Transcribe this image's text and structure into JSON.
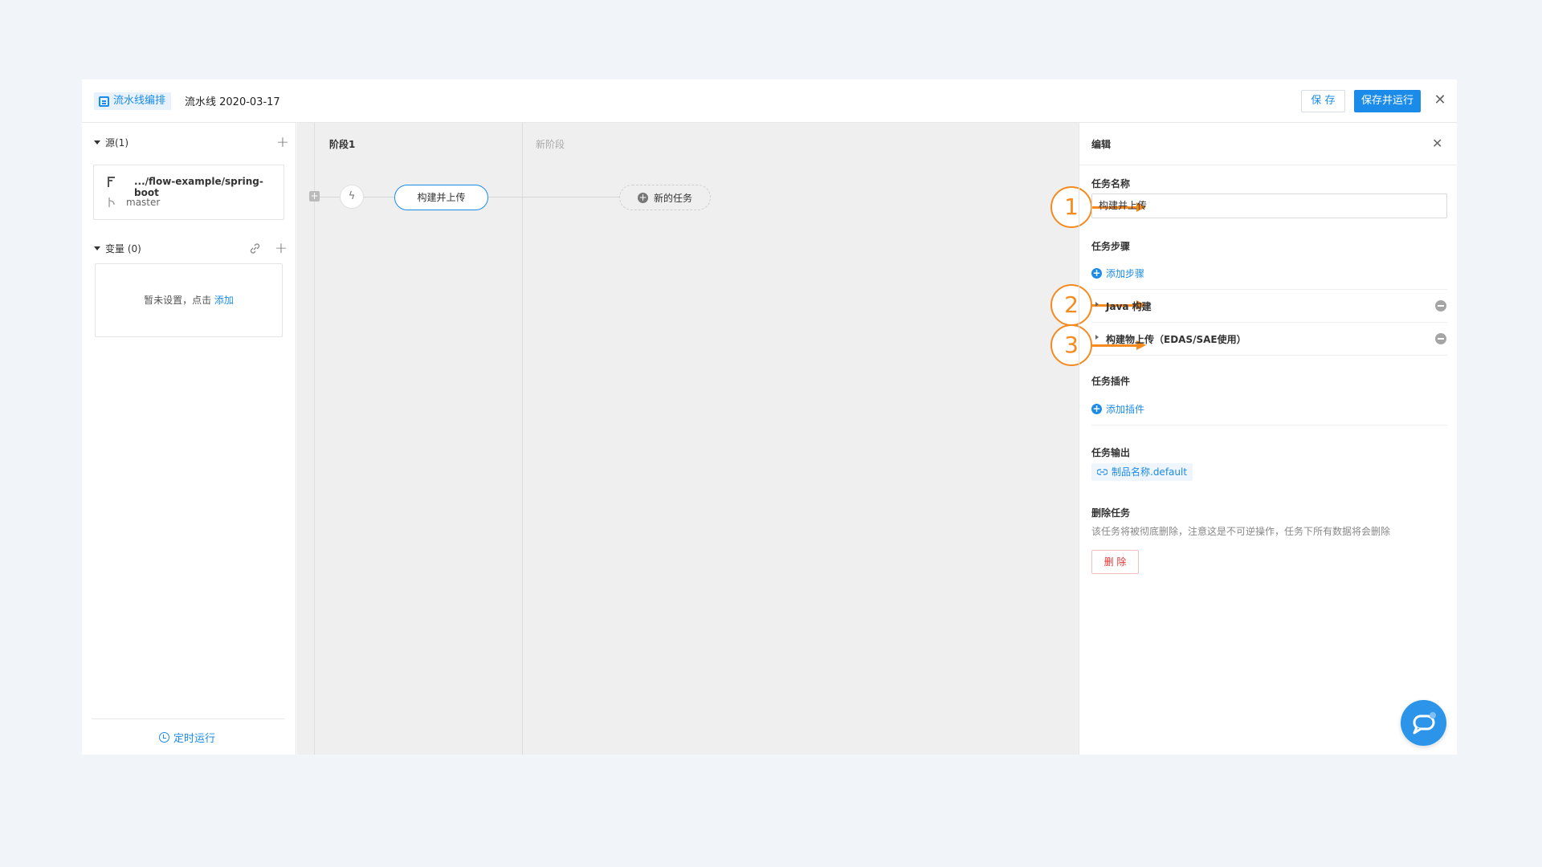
{
  "header": {
    "tag_label": "流水线编排",
    "pipeline_name": "流水线 2020-03-17",
    "save_label": "保 存",
    "save_run_label": "保存并运行",
    "close_icon": "close-icon"
  },
  "left_panel": {
    "source_title": "源(1)",
    "source_path": ".../flow-example/spring-boot",
    "source_branch": "master",
    "variables_title": "变量 (0)",
    "variables_empty_text": "暂未设置，点击 ",
    "variables_add_link": "添加",
    "timer_label": "定时运行"
  },
  "canvas": {
    "stage_title": "阶段1",
    "new_stage_label": "新阶段",
    "task_label": "构建并上传",
    "new_task_label": "新的任务"
  },
  "annotations": [
    "1",
    "2",
    "3"
  ],
  "editor": {
    "title": "编辑",
    "task_name_label": "任务名称",
    "task_name_value": "构建并上传",
    "task_steps_label": "任务步骤",
    "add_step_label": "添加步骤",
    "steps": [
      "Java 构建",
      "构建物上传（EDAS/SAE使用）"
    ],
    "task_plugins_label": "任务插件",
    "add_plugin_label": "添加插件",
    "task_output_label": "任务输出",
    "output_value": "制品名称.default",
    "delete_title": "删除任务",
    "delete_desc": "该任务将被彻底删除，注意这是不可逆操作，任务下所有数据将会删除",
    "delete_button": "删 除"
  },
  "colors": {
    "accent": "#1b8bea",
    "annotation": "#f58a1f",
    "danger": "#ee3333"
  }
}
